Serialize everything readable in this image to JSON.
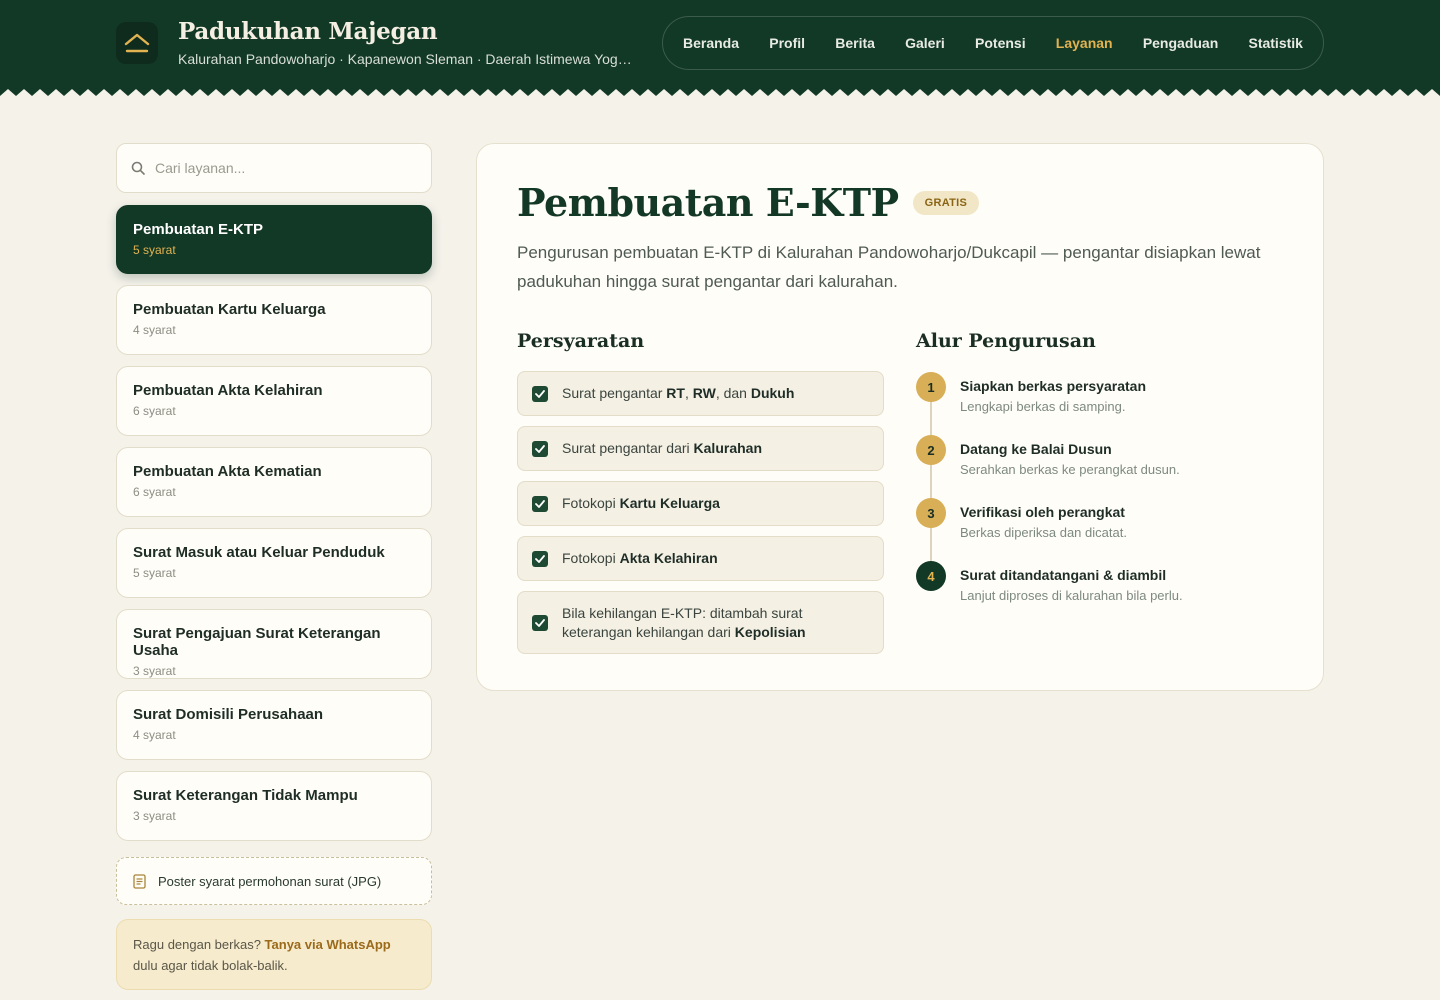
{
  "header": {
    "title": "Padukuhan Majegan",
    "subtitle": "Kalurahan Pandowoharjo · Kapanewon Sleman · Daerah Istimewa Yogya...",
    "logo_icon": "roof-chevron-icon",
    "nav": [
      {
        "label": "Beranda",
        "active": false
      },
      {
        "label": "Profil",
        "active": false
      },
      {
        "label": "Berita",
        "active": false
      },
      {
        "label": "Galeri",
        "active": false
      },
      {
        "label": "Potensi",
        "active": false
      },
      {
        "label": "Layanan",
        "active": true
      },
      {
        "label": "Pengaduan",
        "active": false
      },
      {
        "label": "Statistik",
        "active": false
      }
    ]
  },
  "sidebar": {
    "search": {
      "placeholder": "Cari layanan...",
      "value": ""
    },
    "services": [
      {
        "name": "Pembuatan E-KTP",
        "count": "5 syarat",
        "active": true
      },
      {
        "name": "Pembuatan Kartu Keluarga",
        "count": "4 syarat",
        "active": false
      },
      {
        "name": "Pembuatan Akta Kelahiran",
        "count": "6 syarat",
        "active": false
      },
      {
        "name": "Pembuatan Akta Kematian",
        "count": "6 syarat",
        "active": false
      },
      {
        "name": "Surat Masuk atau Keluar Penduduk",
        "count": "5 syarat",
        "active": false
      },
      {
        "name": "Surat Pengajuan Surat Keterangan Usaha",
        "count": "3 syarat",
        "active": false
      },
      {
        "name": "Surat Domisili Perusahaan",
        "count": "4 syarat",
        "active": false
      },
      {
        "name": "Surat Keterangan Tidak Mampu",
        "count": "3 syarat",
        "active": false
      }
    ],
    "poster": "Poster syarat permohonan surat (JPG)",
    "help": {
      "prefix": "Ragu dengan berkas? ",
      "link": "Tanya via WhatsApp",
      "suffix": " dulu agar tidak bolak-balik."
    }
  },
  "main": {
    "title": "Pembuatan E-KTP",
    "badge": "GRATIS",
    "description": "Pengurusan pembuatan E-KTP di Kalurahan Pandowoharjo/Dukcapil — pengantar disiapkan lewat padukuhan hingga surat pengantar dari kalurahan.",
    "requirements_title": "Persyaratan",
    "requirements": [
      [
        {
          "t": "Surat pengantar "
        },
        {
          "t": "RT",
          "b": true
        },
        {
          "t": ", "
        },
        {
          "t": "RW",
          "b": true
        },
        {
          "t": ", dan "
        },
        {
          "t": "Dukuh",
          "b": true
        }
      ],
      [
        {
          "t": "Surat pengantar dari "
        },
        {
          "t": "Kalurahan",
          "b": true
        }
      ],
      [
        {
          "t": "Fotokopi "
        },
        {
          "t": "Kartu Keluarga",
          "b": true
        }
      ],
      [
        {
          "t": "Fotokopi "
        },
        {
          "t": "Akta Kelahiran",
          "b": true
        }
      ],
      [
        {
          "t": "Bila kehilangan E-KTP: ditambah surat keterangan kehilangan dari "
        },
        {
          "t": "Kepolisian",
          "b": true
        }
      ]
    ],
    "steps_title": "Alur Pengurusan",
    "steps": [
      {
        "num": "1",
        "title": "Siapkan berkas persyaratan",
        "sub": "Lengkapi berkas di samping."
      },
      {
        "num": "2",
        "title": "Datang ke Balai Dusun",
        "sub": "Serahkan berkas ke perangkat dusun."
      },
      {
        "num": "3",
        "title": "Verifikasi oleh perangkat",
        "sub": "Berkas diperiksa dan dicatat."
      },
      {
        "num": "4",
        "title": "Surat ditandatangani & diambil",
        "sub": "Lanjut diproses di kalurahan bila perlu."
      }
    ]
  },
  "colors": {
    "primary": "#123826",
    "accent": "#e2b350",
    "background": "#f5f2ea"
  }
}
